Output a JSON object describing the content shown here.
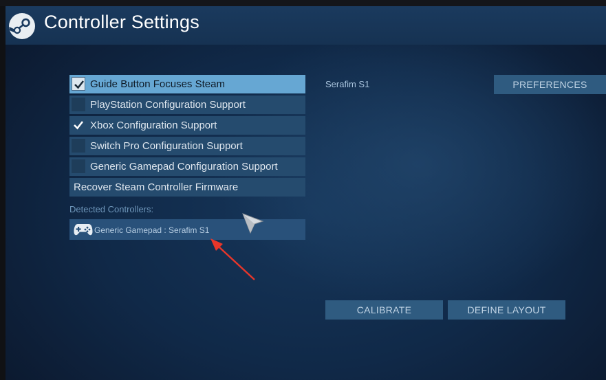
{
  "header": {
    "title": "Controller Settings"
  },
  "options": [
    {
      "label": "Guide Button Focuses Steam",
      "checked": true,
      "selected": true
    },
    {
      "label": "PlayStation Configuration Support",
      "checked": false
    },
    {
      "label": "Xbox Configuration Support",
      "checked": true
    },
    {
      "label": "Switch Pro Configuration Support",
      "checked": false
    },
    {
      "label": "Generic Gamepad Configuration Support",
      "checked": false
    }
  ],
  "firmware_button": "Recover Steam Controller Firmware",
  "detected": {
    "label": "Detected Controllers:",
    "controllers": [
      {
        "name": "Generic Gamepad : Serafim S1",
        "icon": "gamepad-icon"
      }
    ]
  },
  "right_panel": {
    "controller_name": "Serafim S1",
    "preferences_label": "PREFERENCES",
    "calibrate_label": "CALIBRATE",
    "define_layout_label": "DEFINE LAYOUT"
  },
  "colors": {
    "accent": "#66a7d3",
    "button": "#2f5b80",
    "annotation_arrow": "#e8362a"
  }
}
